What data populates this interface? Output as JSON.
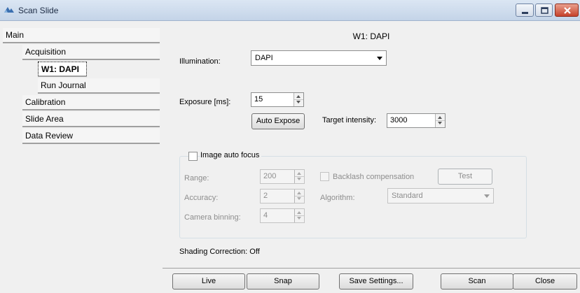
{
  "window": {
    "title": "Scan Slide"
  },
  "sidebar": {
    "items": [
      {
        "label": "Main"
      },
      {
        "label": "Acquisition"
      },
      {
        "label": "W1: DAPI"
      },
      {
        "label": "Run Journal"
      },
      {
        "label": "Calibration"
      },
      {
        "label": "Slide Area"
      },
      {
        "label": "Data Review"
      }
    ]
  },
  "panel": {
    "title": "W1: DAPI",
    "illumination": {
      "label": "Illumination:",
      "value": "DAPI"
    },
    "exposure": {
      "label": "Exposure [ms]:",
      "value": "15"
    },
    "auto_expose_label": "Auto Expose",
    "target_intensity": {
      "label": "Target intensity:",
      "value": "3000"
    },
    "autofocus": {
      "checkbox_label": "Image auto focus",
      "checked": false,
      "range": {
        "label": "Range:",
        "value": "200"
      },
      "accuracy": {
        "label": "Accuracy:",
        "value": "2"
      },
      "camera_binning": {
        "label": "Camera binning:",
        "value": "4"
      },
      "backlash": {
        "label": "Backlash compensation",
        "checked": false
      },
      "test_label": "Test",
      "algorithm": {
        "label": "Algorithm:",
        "value": "Standard"
      }
    },
    "shading_correction": "Shading Correction: Off"
  },
  "footer": {
    "live": "Live",
    "snap": "Snap",
    "save_settings": "Save Settings...",
    "scan": "Scan",
    "close": "Close"
  },
  "icons": {
    "app": "scan-slide-app-icon",
    "minimize": "minimize-icon",
    "maximize": "maximize-icon",
    "close": "close-icon"
  },
  "colors": {
    "titlebar": "#c4d4e8",
    "close_button": "#c6422b",
    "disabled_text": "#8d8d8d"
  }
}
